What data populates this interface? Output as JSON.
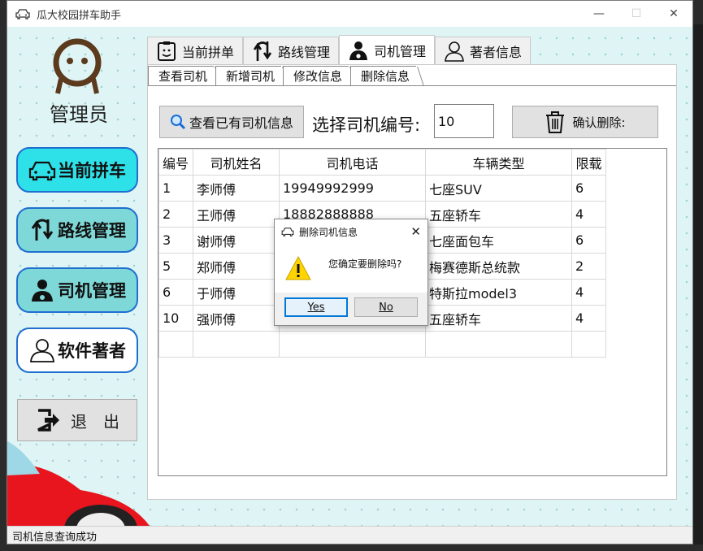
{
  "window": {
    "title": "瓜大校园拼车助手",
    "minimize_glyph": "—",
    "maximize_glyph": "☐",
    "close_glyph": "✕"
  },
  "sidebar": {
    "role": "管理员",
    "items": [
      {
        "label": "当前拼车",
        "icon": "car-icon",
        "active": true
      },
      {
        "label": "路线管理",
        "icon": "route-icon"
      },
      {
        "label": "司机管理",
        "icon": "driver-icon"
      },
      {
        "label": "软件著者",
        "icon": "person-outline-icon"
      }
    ],
    "exit_label": "退　出"
  },
  "tabs": [
    {
      "label": "当前拼单",
      "icon": "smiley-clipboard-icon"
    },
    {
      "label": "路线管理",
      "icon": "route-icon"
    },
    {
      "label": "司机管理",
      "icon": "driver-icon",
      "active": true
    },
    {
      "label": "著者信息",
      "icon": "person-outline-icon"
    }
  ],
  "subtabs": [
    {
      "label": "查看司机"
    },
    {
      "label": "新增司机"
    },
    {
      "label": "修改信息"
    },
    {
      "label": "删除信息",
      "active": true
    }
  ],
  "toolbar": {
    "view_label": "查看已有司机信息",
    "select_label": "选择司机编号:",
    "select_value": "10",
    "delete_label": "确认删除:"
  },
  "table": {
    "columns": [
      "编号",
      "司机姓名",
      "司机电话",
      "车辆类型",
      "限载"
    ],
    "rows": [
      [
        "1",
        "李师傅",
        "19949992999",
        "七座SUV",
        "6"
      ],
      [
        "2",
        "王师傅",
        "18882888888",
        "五座轿车",
        "4"
      ],
      [
        "3",
        "谢师傅",
        "",
        "七座面包车",
        "6"
      ],
      [
        "5",
        "郑师傅",
        "",
        "梅赛德斯总统款",
        "2"
      ],
      [
        "6",
        "于师傅",
        "",
        "特斯拉model3",
        "4"
      ],
      [
        "10",
        "强师傅",
        "",
        "五座轿车",
        "4"
      ],
      [
        "",
        "",
        "",
        "",
        ""
      ]
    ]
  },
  "status": "司机信息查询成功",
  "dialog": {
    "title": "删除司机信息",
    "message": "您确定要删除吗?",
    "yes_label": "Yes",
    "no_label": "No"
  },
  "colors": {
    "sidebar_active": "#2ee0e8",
    "sidebar_button": "#7fd8d8",
    "sidebar_border": "#1f6fd0",
    "client_bg": "#dff5f5"
  }
}
